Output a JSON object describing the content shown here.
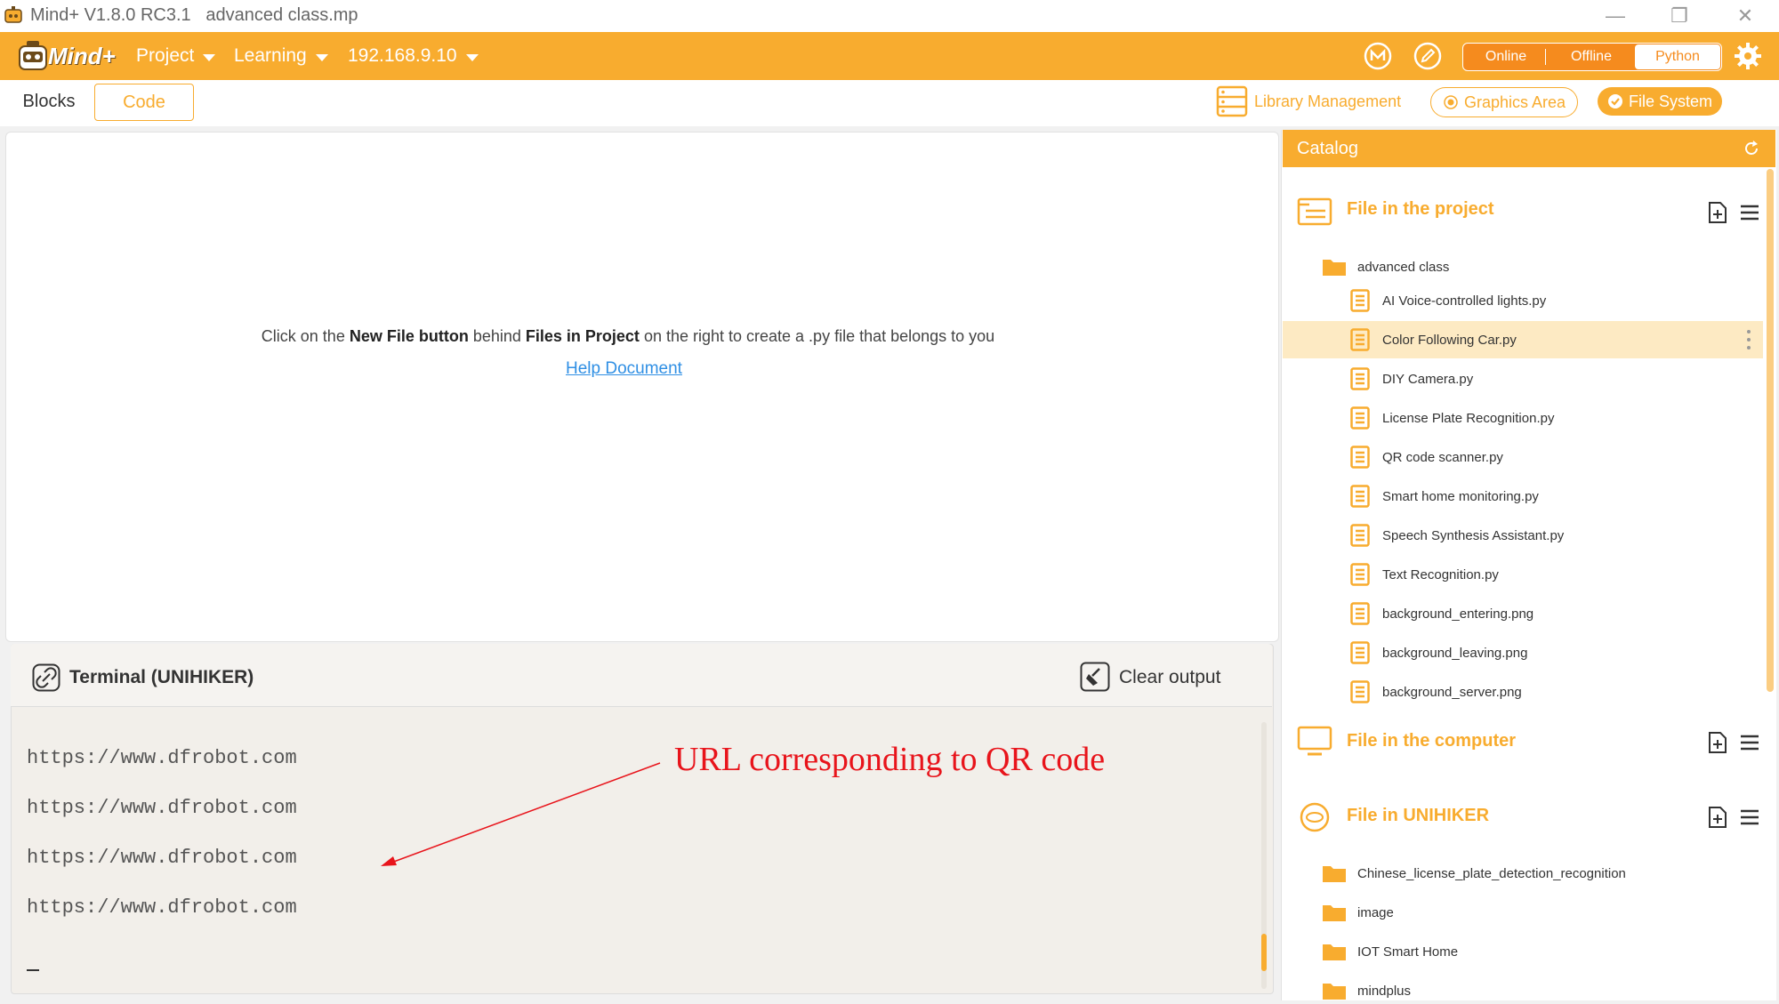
{
  "window": {
    "title": "Mind+ V1.8.0 RC3.1",
    "filename": "advanced class.mp",
    "minimize": "—",
    "restore": "❐",
    "close": "✕"
  },
  "menu": {
    "logo": "Mind+",
    "project": "Project",
    "learning": "Learning",
    "device": "192.168.9.10"
  },
  "mode": {
    "online": "Online",
    "offline": "Offline",
    "python": "Python",
    "active": "Python"
  },
  "tabs": {
    "blocks": "Blocks",
    "code": "Code"
  },
  "toolbar": {
    "library": "Library Management",
    "graphics": "Graphics Area",
    "files": "File System"
  },
  "editor": {
    "hint_pre": "Click on the ",
    "hint_b1": "New File button",
    "hint_mid": " behind ",
    "hint_b2": "Files in Project",
    "hint_post": " on the right to create a .py file that belongs to you",
    "help_link": "Help Document"
  },
  "terminal": {
    "title": "Terminal (UNIHIKER)",
    "clear": "Clear output",
    "lines": [
      "https://www.dfrobot.com",
      "https://www.dfrobot.com",
      "https://www.dfrobot.com",
      "https://www.dfrobot.com"
    ]
  },
  "annotation": {
    "text": "URL corresponding to QR code"
  },
  "catalog": {
    "title": "Catalog",
    "project_section": "File in the project",
    "project_folder": "advanced class",
    "project_files": [
      "AI Voice-controlled lights.py",
      "Color Following Car.py",
      "DIY Camera.py",
      "License Plate Recognition.py",
      "QR code scanner.py",
      "Smart home monitoring.py",
      "Speech Synthesis Assistant.py",
      "Text Recognition.py",
      "background_entering.png",
      "background_leaving.png",
      "background_server.png"
    ],
    "selected_file": "Color Following Car.py",
    "computer_section": "File in the computer",
    "unihiker_section": "File in UNIHIKER",
    "unihiker_folders": [
      "Chinese_license_plate_detection_recognition",
      "image",
      "IOT Smart Home",
      "mindplus"
    ]
  },
  "colors": {
    "accent": "#f8ac2f",
    "selected_row": "#fdeac3",
    "annotation": "#e8141b",
    "link": "#2f8fe4"
  }
}
